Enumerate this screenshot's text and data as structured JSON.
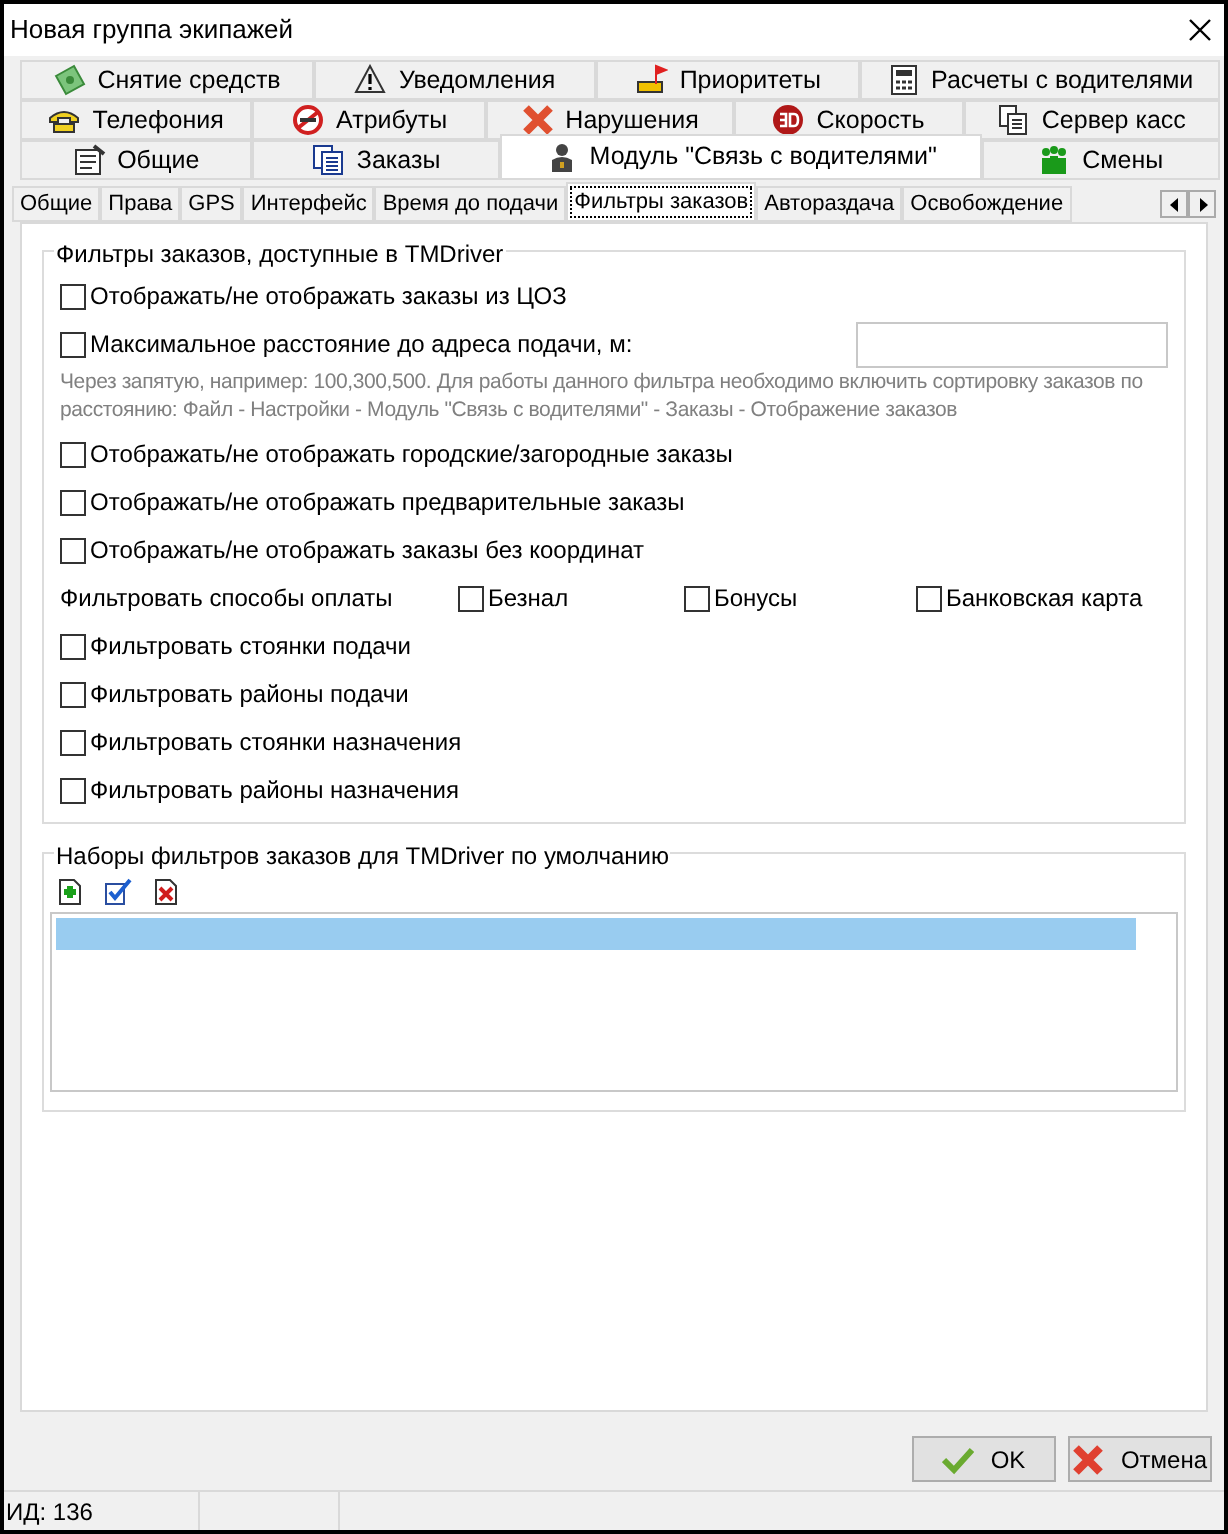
{
  "window": {
    "title": "Новая группа экипажей"
  },
  "tab_rows": [
    [
      {
        "label": "Снятие средств",
        "selected": false
      },
      {
        "label": "Уведомления",
        "selected": false
      },
      {
        "label": "Приоритеты",
        "selected": false
      },
      {
        "label": "Расчеты с водителями",
        "selected": false
      }
    ],
    [
      {
        "label": "Телефония",
        "selected": false
      },
      {
        "label": "Атрибуты",
        "selected": false
      },
      {
        "label": "Нарушения",
        "selected": false
      },
      {
        "label": "Скорость",
        "selected": false
      },
      {
        "label": "Сервер касс",
        "selected": false
      }
    ],
    [
      {
        "label": "Общие",
        "selected": false
      },
      {
        "label": "Заказы",
        "selected": false
      },
      {
        "label": "Модуль \"Связь с водителями\"",
        "selected": true
      },
      {
        "label": "Смены",
        "selected": false
      }
    ]
  ],
  "subtabs": [
    {
      "label": "Общие",
      "selected": false
    },
    {
      "label": "Права",
      "selected": false
    },
    {
      "label": "GPS",
      "selected": false
    },
    {
      "label": "Интерфейс",
      "selected": false
    },
    {
      "label": "Время до подачи",
      "selected": false
    },
    {
      "label": "Фильтры заказов",
      "selected": true
    },
    {
      "label": "Автораздача",
      "selected": false
    },
    {
      "label": "Освобождение",
      "selected": false
    }
  ],
  "filters_group": {
    "title": "Фильтры заказов, доступные в TMDriver",
    "items": [
      {
        "kind": "checkbox",
        "label": "Отображать/не отображать заказы из ЦОЗ",
        "checked": false
      },
      {
        "kind": "checkbox_input",
        "label": "Максимальное расстояние до адреса подачи, м:",
        "checked": false
      },
      {
        "kind": "hint",
        "text": "Через запятую, например: 100,300,500.  Для работы данного фильтра необходимо включить сортировку заказов по расстоянию: Файл - Настройки - Модуль \"Связь с водителями\" - Заказы - Отображение заказов"
      },
      {
        "kind": "checkbox",
        "label": "Отображать/не отображать городские/загородные заказы",
        "checked": false
      },
      {
        "kind": "checkbox",
        "label": "Отображать/не отображать предварительные заказы",
        "checked": false
      },
      {
        "kind": "checkbox",
        "label": "Отображать/не отображать заказы без координат",
        "checked": false
      },
      {
        "kind": "option_row",
        "label": "Фильтровать способы оплаты",
        "options": [
          {
            "label": "Безнал",
            "checked": false
          },
          {
            "label": "Бонусы",
            "checked": false
          },
          {
            "label": "Банковская карта",
            "checked": false
          }
        ]
      },
      {
        "kind": "checkbox",
        "label": "Фильтровать стоянки подачи",
        "checked": false
      },
      {
        "kind": "checkbox",
        "label": "Фильтровать районы подачи",
        "checked": false
      },
      {
        "kind": "checkbox",
        "label": "Фильтровать стоянки назначения",
        "checked": false
      },
      {
        "kind": "checkbox",
        "label": "Фильтровать районы назначения",
        "checked": false
      }
    ]
  },
  "sets_group": {
    "title": "Наборы фильтров заказов для TMDriver по умолчанию",
    "rows": [
      {
        "selected": true
      }
    ]
  },
  "buttons": [
    {
      "kind": "ok",
      "label": "OK"
    },
    {
      "kind": "cancel",
      "label": "Отмена"
    }
  ],
  "status_bar": {
    "id": "ИД: 136"
  }
}
